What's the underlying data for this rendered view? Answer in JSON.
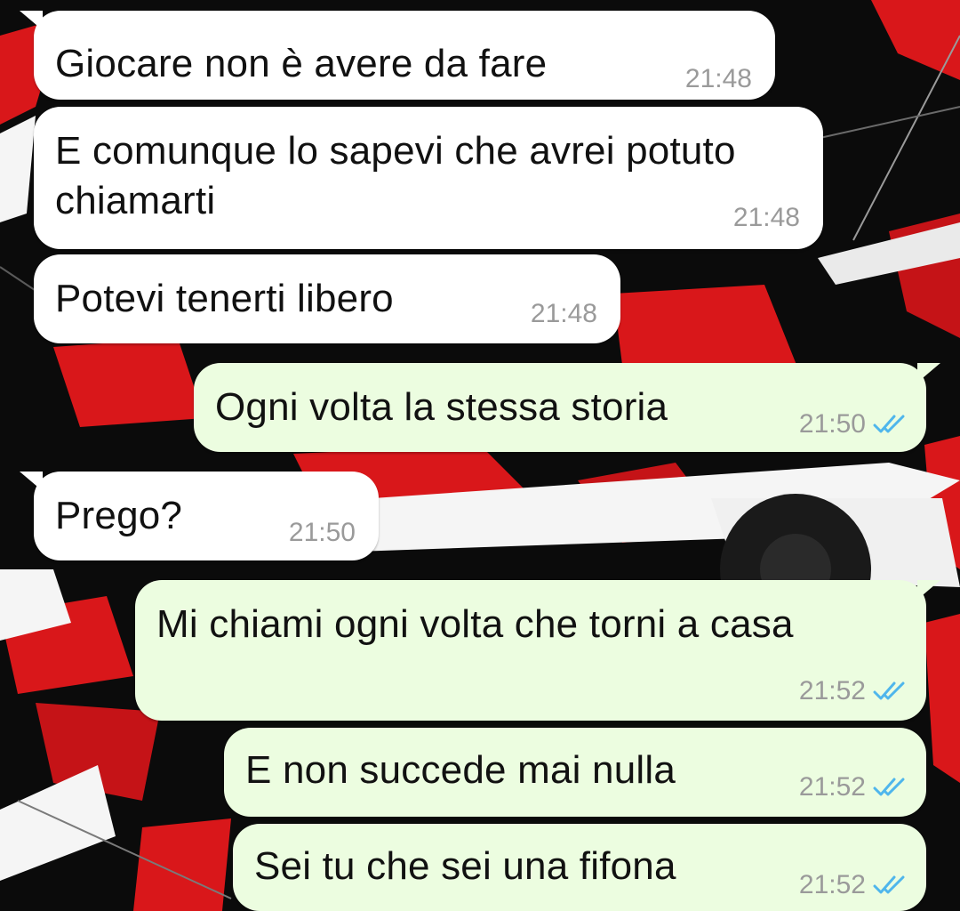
{
  "colors": {
    "incoming_bubble": "#ffffff",
    "outgoing_bubble": "#ecfde0",
    "timestamp": "#9a9a9a",
    "read_ticks": "#4fb6ec",
    "wallpaper_red": "#d9171a",
    "wallpaper_black": "#0b0b0b",
    "wallpaper_white": "#f5f5f5"
  },
  "messages": [
    {
      "direction": "incoming",
      "lines": [
        "Giocare non è avere da fare"
      ],
      "time": "21:48"
    },
    {
      "direction": "incoming",
      "lines": [
        "E comunque lo sapevi che avrei potuto",
        "chiamarti"
      ],
      "time": "21:48"
    },
    {
      "direction": "incoming",
      "lines": [
        "Potevi tenerti libero"
      ],
      "time": "21:48"
    },
    {
      "direction": "outgoing",
      "lines": [
        "Ogni volta la stessa storia"
      ],
      "time": "21:50",
      "status_icon": "double-check-read-icon"
    },
    {
      "direction": "incoming",
      "lines": [
        "Prego?"
      ],
      "time": "21:50"
    },
    {
      "direction": "outgoing",
      "lines": [
        "Mi chiami ogni volta che torni a casa"
      ],
      "time": "21:52",
      "status_icon": "double-check-read-icon"
    },
    {
      "direction": "outgoing",
      "lines": [
        "E non succede mai nulla"
      ],
      "time": "21:52",
      "status_icon": "double-check-read-icon"
    },
    {
      "direction": "outgoing",
      "lines": [
        "Sei tu che sei una fifona"
      ],
      "time": "21:52",
      "status_icon": "double-check-read-icon"
    }
  ]
}
